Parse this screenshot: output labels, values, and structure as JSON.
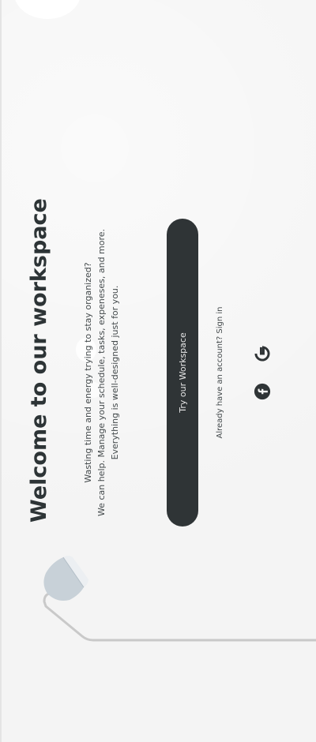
{
  "header": {
    "title": "Welcome to our workspace"
  },
  "intro": {
    "lines": [
      "Wasting time and energy trying to stay organized?",
      "We can help. Manage your schedule, tasks, expeneses, and more.",
      "Everything is well-designed just for you."
    ]
  },
  "cta": {
    "label": "Try our Workspace"
  },
  "auth": {
    "signin_text": "Already have an account? Sign in"
  },
  "social": {
    "items": [
      {
        "icon": "facebook-icon"
      },
      {
        "icon": "google-icon"
      }
    ]
  },
  "colors": {
    "background": "#f4f4f4",
    "button": "#2f3436",
    "title": "#2d3436",
    "lamp_shade": "#c8d1d8",
    "cord": "#c9c9c9"
  }
}
